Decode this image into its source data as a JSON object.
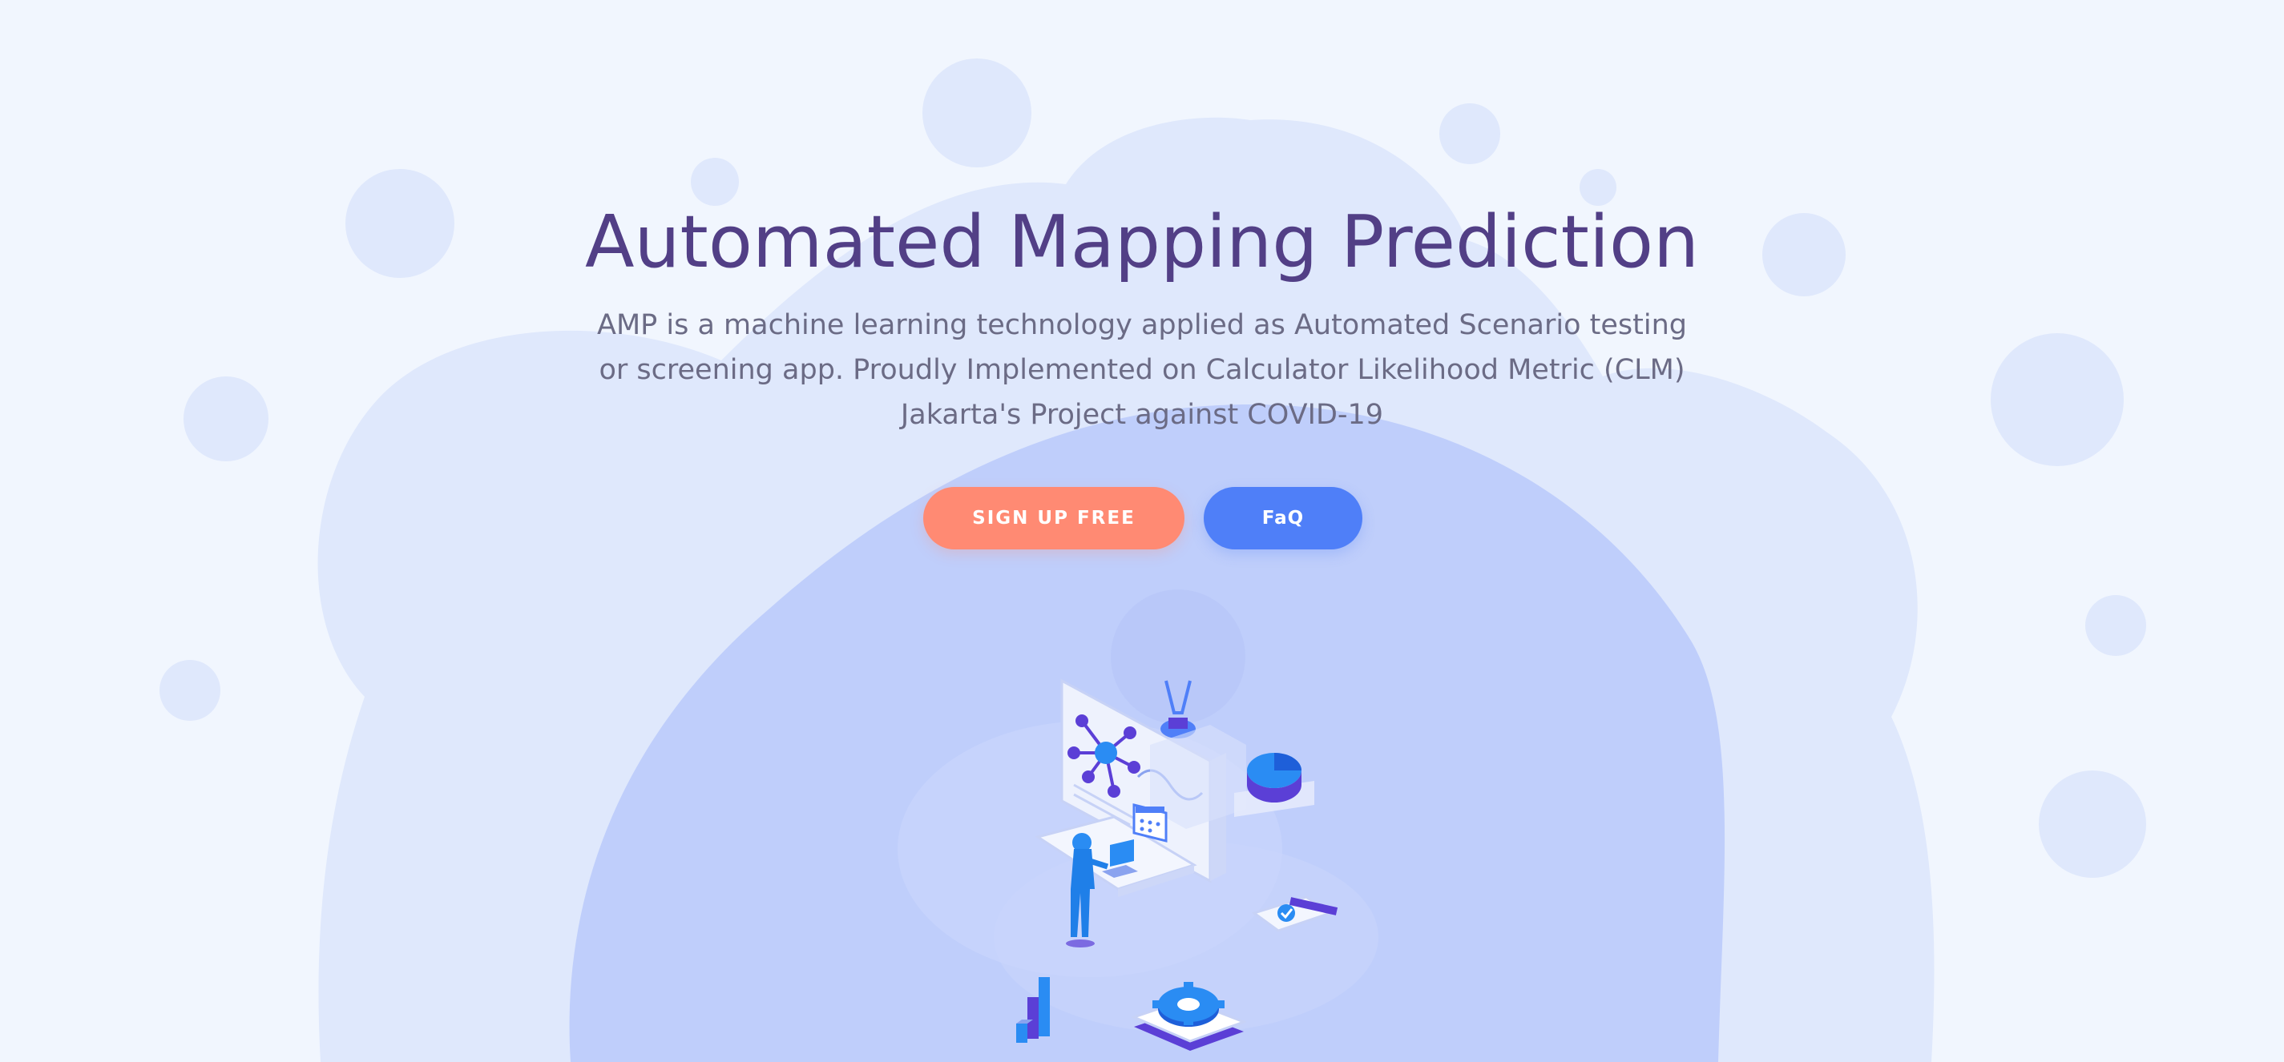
{
  "hero": {
    "title": "Automated Mapping Prediction",
    "subtitle": "AMP is a machine learning technology applied as Automated Scenario testing or screening app. Proudly Implemented on Calculator Likelihood Metric (CLM) Jakarta's Project against COVID-19"
  },
  "buttons": {
    "signup_label": "SIGN UP FREE",
    "faq_label": "FaQ"
  },
  "colors": {
    "background": "#f1f6fe",
    "blob_light": "#dfe8fc",
    "blob_mid": "#bfcefb",
    "title": "#523f86",
    "subtitle": "#6b6b85",
    "signup": "#ff8a73",
    "faq": "#4f7ff8",
    "illustration_blue": "#2a8cf3",
    "illustration_purple": "#5b3fd6"
  },
  "illustration": {
    "icons": [
      "network-graph-icon",
      "lightbulb-icon",
      "pie-chart-icon",
      "calendar-icon",
      "person-icon",
      "laptop-icon",
      "bar-chart-icon",
      "gear-icon",
      "checkmark-card-icon"
    ]
  }
}
